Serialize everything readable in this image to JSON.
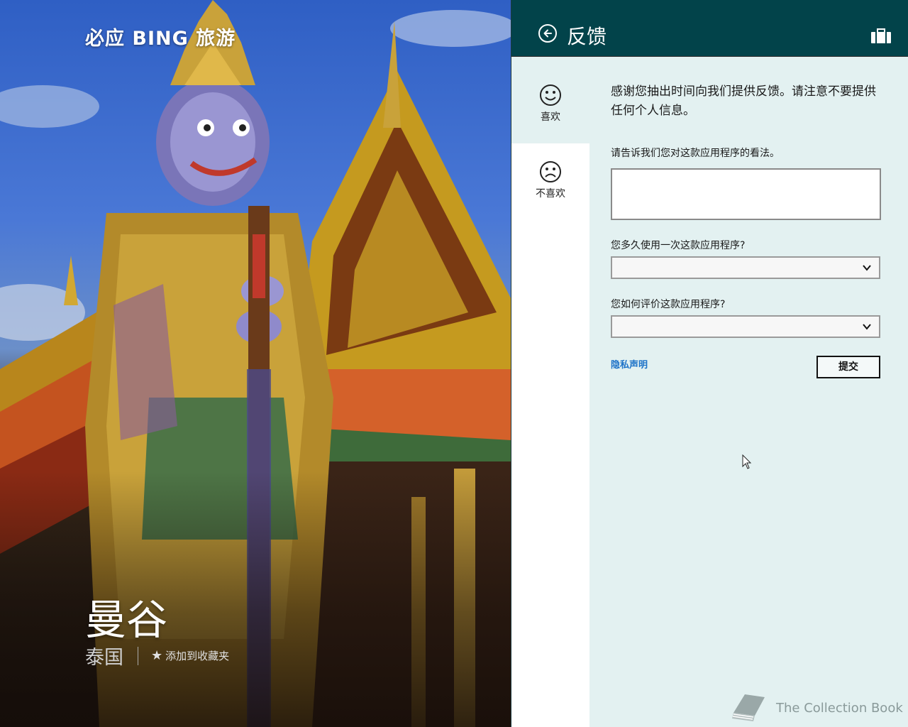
{
  "hero": {
    "app_title": "必应 BING 旅游",
    "city": "曼谷",
    "country": "泰国",
    "favorite_label": "添加到收藏夹"
  },
  "panel": {
    "title": "反馈",
    "like_label": "喜欢",
    "dislike_label": "不喜欢",
    "intro_text": "感谢您抽出时间向我们提供反馈。请注意不要提供任何个人信息。",
    "question_opinion": "请告诉我们您对这款应用程序的看法。",
    "opinion_value": "",
    "question_frequency": "您多久使用一次这款应用程序?",
    "frequency_value": "",
    "question_rating": "您如何评价这款应用程序?",
    "rating_value": "",
    "privacy_link": "隐私声明",
    "submit_label": "提交"
  },
  "watermark": {
    "text": "The Collection Book"
  },
  "colors": {
    "header_bg": "#02434a",
    "panel_bg": "#e3f1f1",
    "link": "#1e73c8"
  },
  "icons": {
    "back": "back-arrow-circle-icon",
    "briefcase": "briefcase-icon",
    "like": "smiley-face-icon",
    "dislike": "sad-face-icon",
    "star": "star-icon",
    "chevron": "chevron-down-icon"
  }
}
